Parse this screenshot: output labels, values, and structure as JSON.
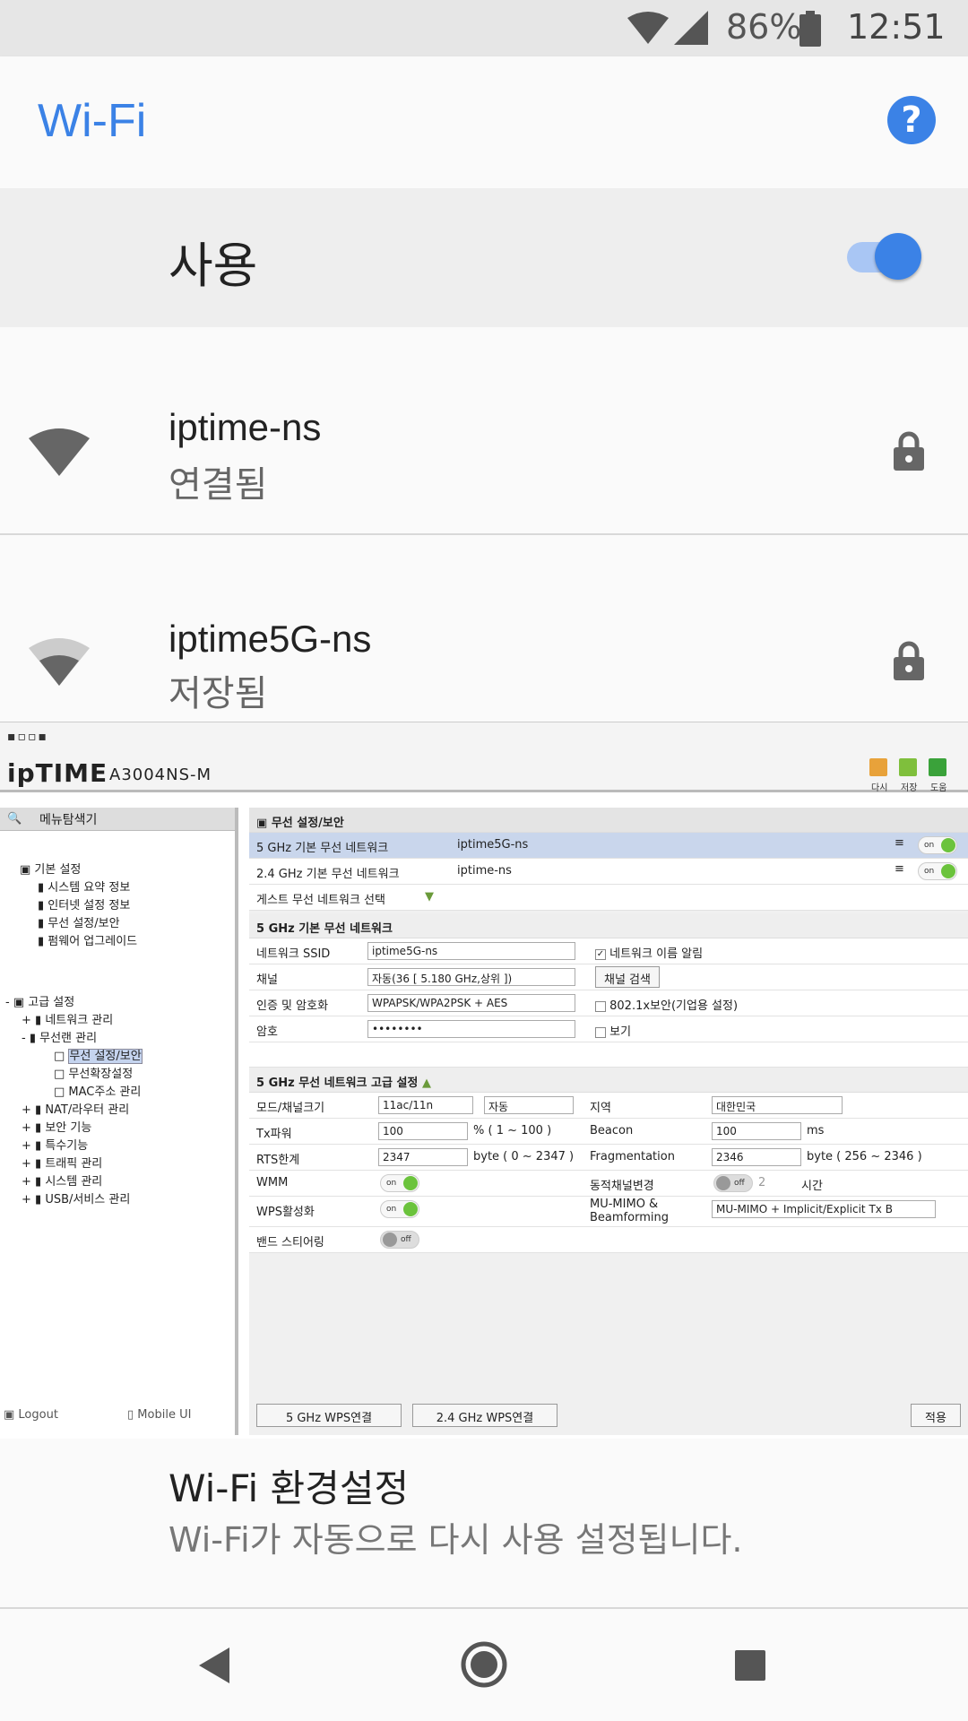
{
  "status_bar": {
    "battery": "86%",
    "time": "12:51"
  },
  "app_bar": {
    "title": "Wi-Fi",
    "help_icon": "help-icon"
  },
  "wifi_toggle": {
    "label": "사용",
    "enabled": true
  },
  "networks": [
    {
      "ssid": "iptime-ns",
      "status": "연결됨",
      "signal": "full",
      "secured": true
    },
    {
      "ssid": "iptime5G-ns",
      "status": "저장됨",
      "signal": "partial",
      "secured": true
    }
  ],
  "router": {
    "brand": "ipTIME",
    "model": "A3004NS-M",
    "header_icons": [
      {
        "label": "다시",
        "color": "#e8a23a"
      },
      {
        "label": "저장",
        "color": "#7fbf3c"
      },
      {
        "label": "도움",
        "color": "#3aa23a"
      }
    ],
    "sidebar": {
      "title": "메뉴탐색기",
      "basic": {
        "label": "기본 설정",
        "items": [
          "시스템 요약 정보",
          "인터넷 설정 정보",
          "무선 설정/보안",
          "펌웨어 업그레이드"
        ]
      },
      "advanced": {
        "label": "고급 설정",
        "items": [
          "네트워크 관리",
          "무선랜 관리",
          "NAT/라우터 관리",
          "보안 기능",
          "특수기능",
          "트래픽 관리",
          "시스템 관리",
          "USB/서비스 관리"
        ],
        "wireless_sub": [
          "무선 설정/보안",
          "무선확장설정",
          "MAC주소 관리"
        ]
      },
      "logout": "Logout",
      "mobile_ui": "Mobile UI"
    },
    "main": {
      "title": "무선 설정/보안",
      "networks": [
        {
          "label": "5 GHz 기본 무선 네트워크",
          "ssid": "iptime5G-ns",
          "toggle": "on"
        },
        {
          "label": "2.4 GHz 기본 무선 네트워크",
          "ssid": "iptime-ns",
          "toggle": "on"
        }
      ],
      "guest_select": "게스트 무선 네트워크 선택",
      "basic_section": "5 GHz 기본 무선 네트워크",
      "ssid_label": "네트워크 SSID",
      "ssid_value": "iptime5G-ns",
      "broadcast_label": "네트워크 이름 알림",
      "channel_label": "채널",
      "channel_value": "자동(36 [ 5.180 GHz,상위 ])",
      "channel_search": "채널 검색",
      "auth_label": "인증 및 암호화",
      "auth_value": "WPAPSK/WPA2PSK + AES",
      "dot1x_label": "802.1x보안(기업용 설정)",
      "password_label": "암호",
      "password_value": "••••••••",
      "show_label": "보기",
      "advanced_section": "5 GHz 무선 네트워크 고급 설정",
      "mode_label": "모드/채널크기",
      "mode_value": "11ac/11n",
      "width_value": "자동",
      "region_label": "지역",
      "region_value": "대한민국",
      "tx_label": "Tx파워",
      "tx_value": "100",
      "tx_unit": "% ( 1 ~ 100 )",
      "beacon_label": "Beacon",
      "beacon_value": "100",
      "beacon_unit": "ms",
      "rts_label": "RTS한계",
      "rts_value": "2347",
      "rts_unit": "byte ( 0 ~ 2347 )",
      "frag_label": "Fragmentation",
      "frag_value": "2346",
      "frag_unit": "byte ( 256 ~ 2346 )",
      "wmm_label": "WMM",
      "dyn_label": "동적채널변경",
      "dyn_value": "2",
      "dyn_unit": "시간",
      "wps_label": "WPS활성화",
      "mimo_label": "MU-MIMO & Beamforming",
      "mimo_value": "MU-MIMO + Implicit/Explicit Tx B",
      "band_label": "밴드 스티어링",
      "on_text": "on",
      "off_text": "off",
      "wps5_button": "5 GHz WPS연결",
      "wps24_button": "2.4 GHz WPS연결",
      "apply_button": "적용"
    }
  },
  "preferences": {
    "title": "Wi-Fi 환경설정",
    "subtitle": "Wi-Fi가 자동으로 다시 사용 설정됩니다."
  },
  "nav": {
    "back": "back-icon",
    "home": "home-icon",
    "recents": "recents-icon"
  }
}
